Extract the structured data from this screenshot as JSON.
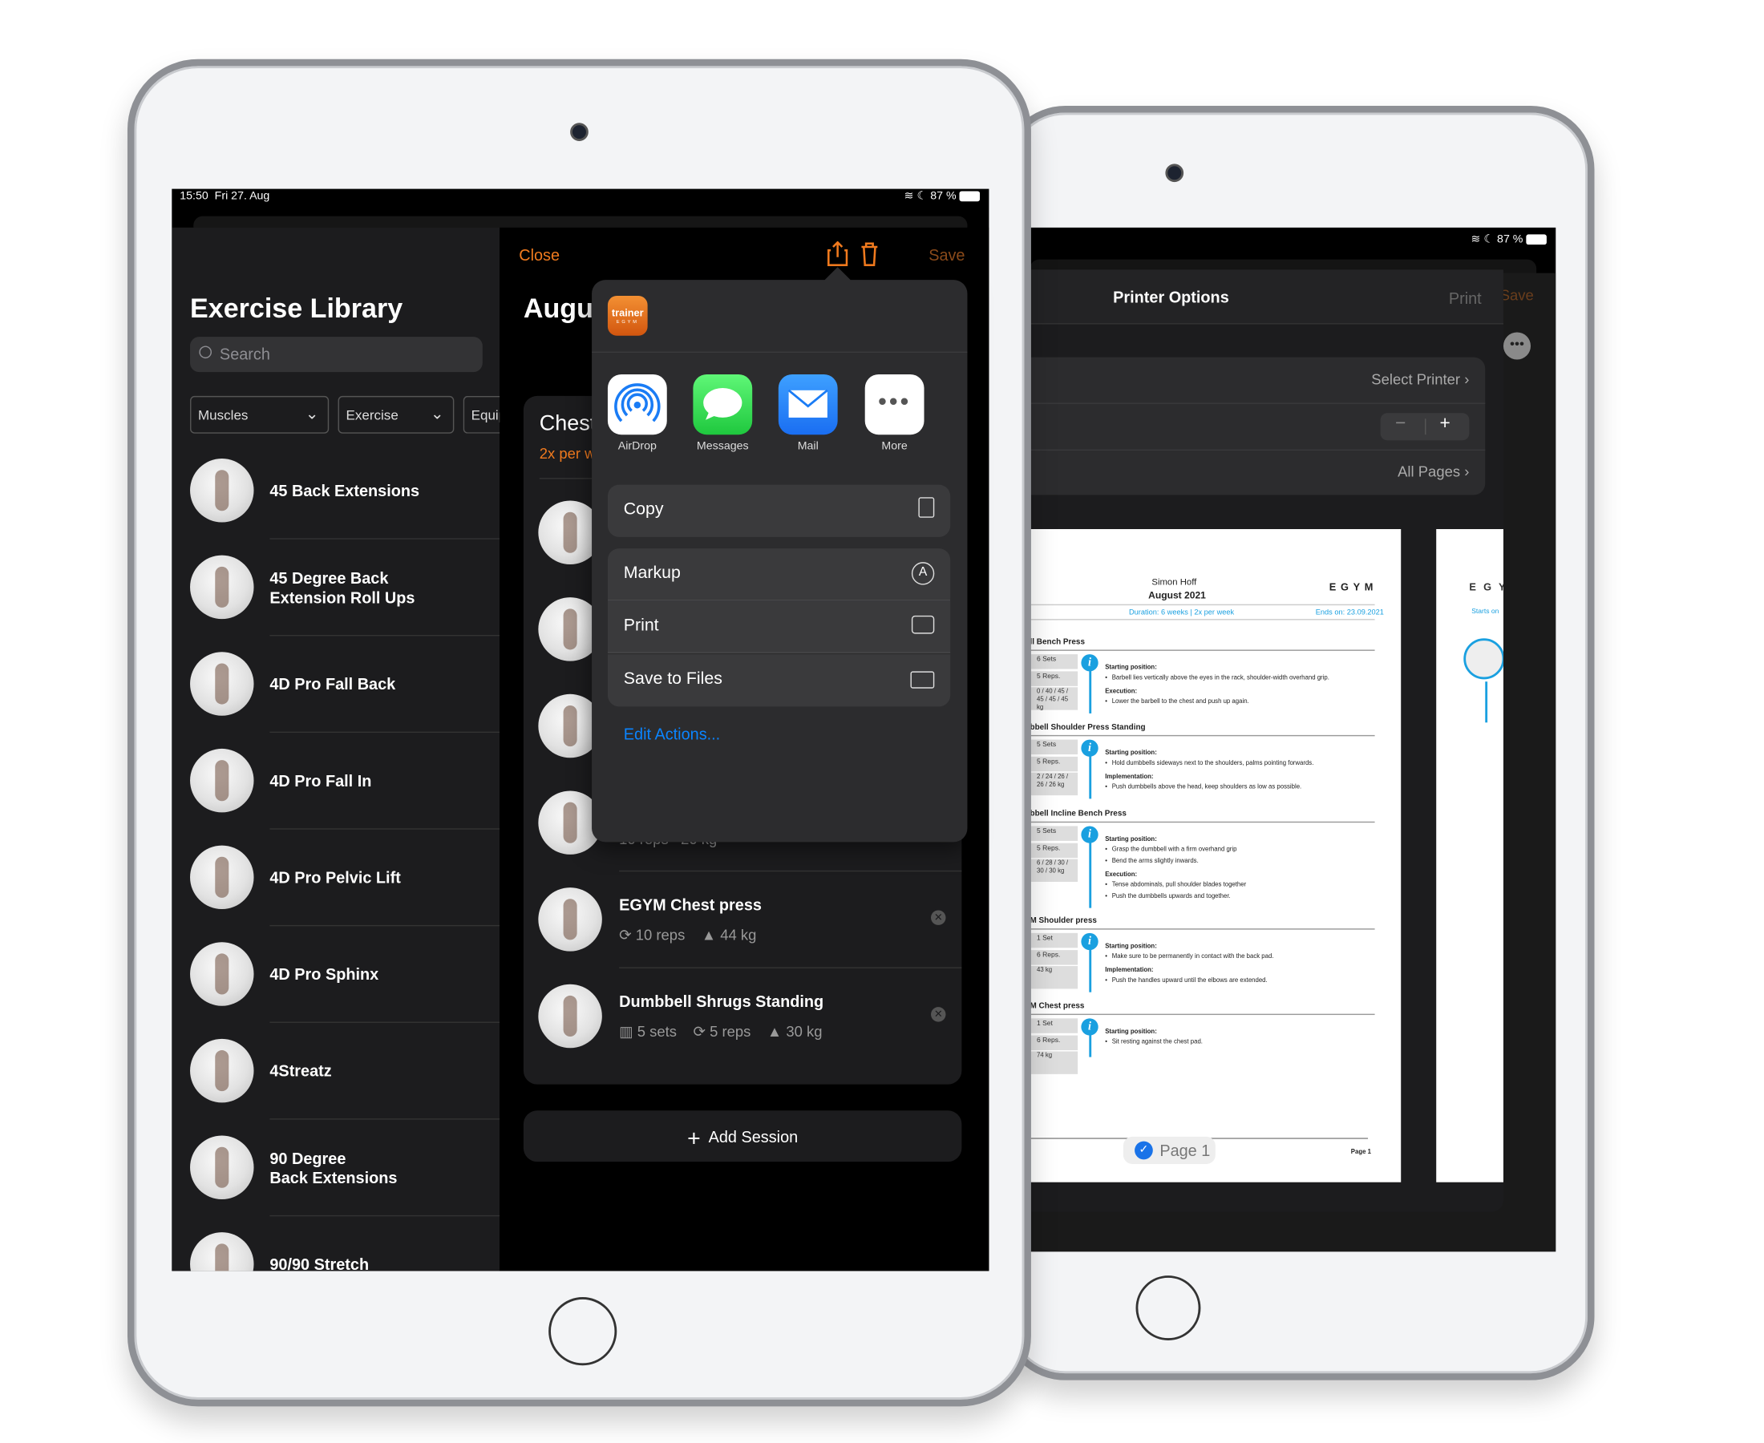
{
  "front": {
    "status": {
      "time": "15:50",
      "date": "Fri 27. Aug",
      "battery": "87 %"
    },
    "library": {
      "title": "Exercise Library",
      "search_placeholder": "Search",
      "filters": [
        "Muscles",
        "Exercise",
        "Equip"
      ],
      "items": [
        {
          "line1": "45 Back Extensions",
          "line2": ""
        },
        {
          "line1": "45 Degree Back",
          "line2": "Extension Roll Ups"
        },
        {
          "line1": "4D Pro Fall Back",
          "line2": ""
        },
        {
          "line1": "4D Pro Fall In",
          "line2": ""
        },
        {
          "line1": "4D Pro Pelvic Lift",
          "line2": ""
        },
        {
          "line1": "4D Pro Sphinx",
          "line2": ""
        },
        {
          "line1": "4Streatz",
          "line2": ""
        },
        {
          "line1": "90 Degree",
          "line2": "Back Extensions"
        },
        {
          "line1": "90/90 Stretch",
          "line2": ""
        }
      ]
    },
    "detail": {
      "close": "Close",
      "save": "Save",
      "title": "Augu",
      "session_title": "Chest",
      "session_freq": "2x per w",
      "hidden_row": {
        "reps": "10 reps",
        "weight": "20 kg"
      },
      "rows": [
        {
          "name": "EGYM Chest press",
          "sets": "",
          "reps": "10 reps",
          "weight": "44 kg"
        },
        {
          "name": "Dumbbell Shrugs Standing",
          "sets": "5 sets",
          "reps": "5 reps",
          "weight": "30 kg"
        }
      ],
      "add_session": "Add Session"
    },
    "share": {
      "app_icon_text": "trainer",
      "app_icon_sub": "EGYM",
      "apps": [
        "AirDrop",
        "Messages",
        "Mail",
        "More"
      ],
      "actions": {
        "copy": "Copy",
        "markup": "Markup",
        "print": "Print",
        "save_files": "Save to Files"
      },
      "edit_actions": "Edit Actions..."
    }
  },
  "back": {
    "status": {
      "battery": "87 %"
    },
    "printer": {
      "title": "Printer Options",
      "print": "Print",
      "save_behind": "Save",
      "select_printer": "Select Printer",
      "stepper_minus": "−",
      "stepper_plus": "+",
      "pages": "All Pages",
      "page_badge": "Page 1"
    },
    "document": {
      "name": "Simon Hoff",
      "month": "August 2021",
      "brand": "EGYM",
      "duration": "Duration: 6 weeks | 2x per week",
      "ends": "Ends on: 23.09.2021",
      "footer": "Page 1",
      "page2_brand": "E G Y",
      "page2_starts": "Starts on",
      "sections": [
        {
          "title": "ll Bench Press",
          "stats": [
            "6 Sets",
            "5 Reps.",
            "0 / 40 / 45 / 45 / 45 / 45 kg"
          ],
          "lines": [
            [
              "Starting position:",
              "Barbell lies vertically above the eyes in the rack, shoulder-width overhand grip."
            ],
            [
              "Execution:",
              "Lower the barbell to the chest and push up again."
            ]
          ]
        },
        {
          "title": "bbell Shoulder Press Standing",
          "stats": [
            "5 Sets",
            "5 Reps.",
            "2 / 24 / 26 / 26 / 26 kg"
          ],
          "lines": [
            [
              "Starting position:",
              "Hold dumbbells sideways next to the shoulders, palms pointing forwards."
            ],
            [
              "Implementation:",
              "Push dumbbells above the head, keep shoulders as low as possible."
            ]
          ]
        },
        {
          "title": "bbell Incline Bench Press",
          "stats": [
            "5 Sets",
            "5 Reps.",
            "6 / 28 / 30 / 30 / 30 kg"
          ],
          "lines": [
            [
              "Starting position:",
              "Grasp the dumbbell with a firm overhand grip",
              "Bend the arms slightly inwards."
            ],
            [
              "Execution:",
              "Tense abdominals, pull shoulder blades together",
              "Push the dumbbells upwards and together."
            ]
          ]
        },
        {
          "title": "M Shoulder press",
          "stats": [
            "1 Set",
            "6 Reps.",
            "43 kg"
          ],
          "lines": [
            [
              "Starting position:",
              "Make sure to be permanently in contact with the back pad."
            ],
            [
              "Implementation:",
              "Push the handles upward until the elbows are extended."
            ]
          ]
        },
        {
          "title": "M Chest press",
          "stats": [
            "1 Set",
            "6 Reps.",
            "74 kg"
          ],
          "lines": [
            [
              "Starting position:",
              "Sit resting against the chest pad."
            ]
          ]
        }
      ]
    }
  },
  "colors": {
    "accent": "#f07a1e",
    "link": "#0a84ff",
    "info": "#1aa0e0",
    "panel": "#1c1c1e",
    "popover": "#2c2c2e"
  }
}
